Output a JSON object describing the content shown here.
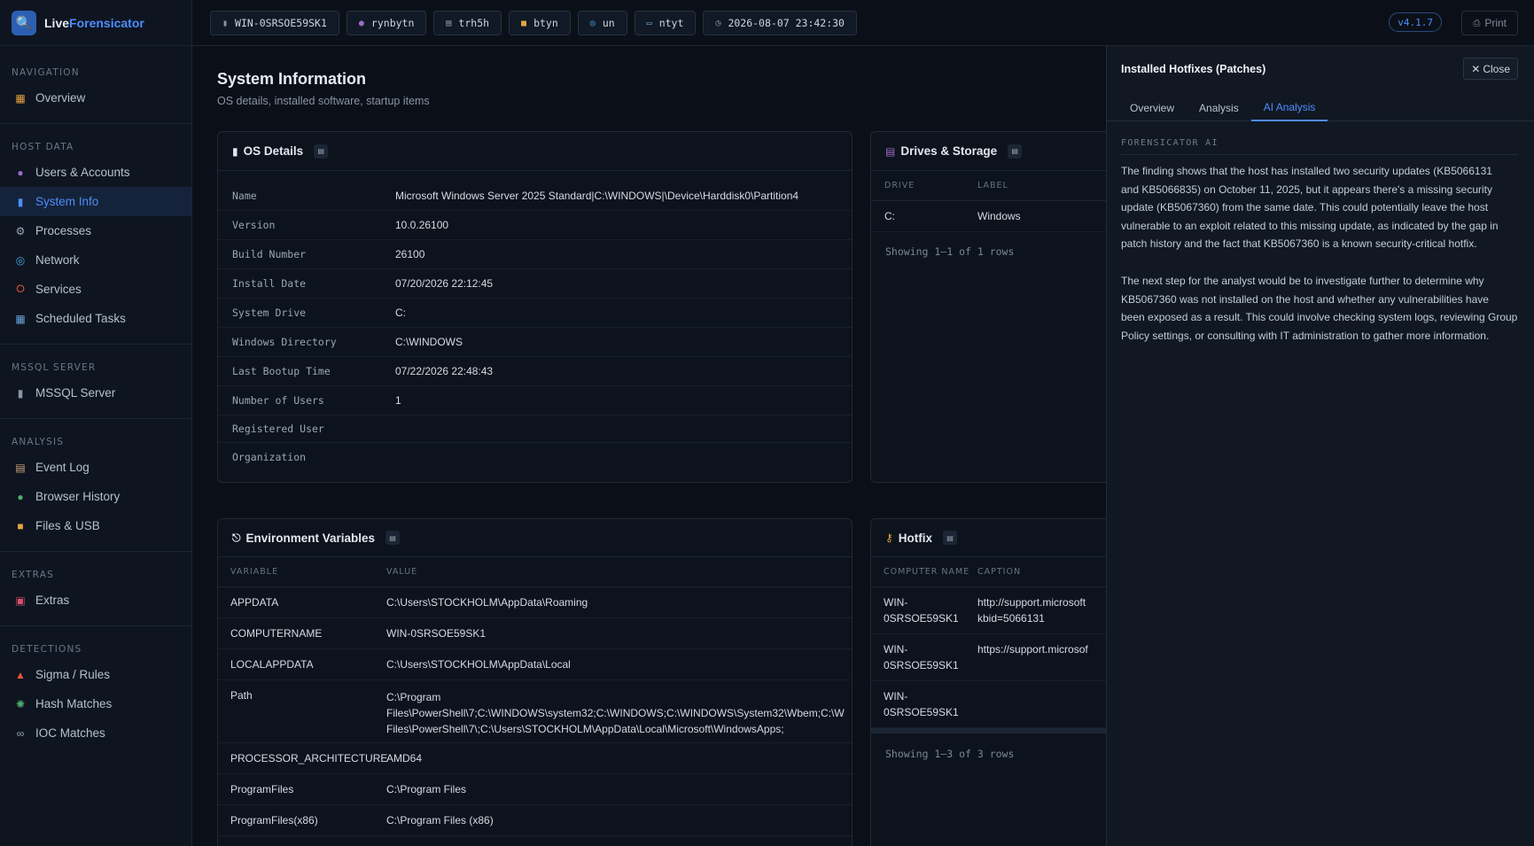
{
  "brand": {
    "prefix": "Live",
    "suffix": "Forensicator"
  },
  "sidebar": {
    "sections": [
      {
        "heading": "NAVIGATION",
        "items": [
          {
            "label": "Overview",
            "icon": "chart-icon"
          }
        ]
      },
      {
        "heading": "HOST DATA",
        "items": [
          {
            "label": "Users & Accounts",
            "icon": "user-icon"
          },
          {
            "label": "System Info",
            "icon": "computer-icon",
            "active": true
          },
          {
            "label": "Processes",
            "icon": "gear-icon"
          },
          {
            "label": "Network",
            "icon": "globe-icon"
          },
          {
            "label": "Services",
            "icon": "bolt-icon"
          },
          {
            "label": "Scheduled Tasks",
            "icon": "calendar-icon"
          }
        ]
      },
      {
        "heading": "MSSQL SERVER",
        "items": [
          {
            "label": "MSSQL Server",
            "icon": "database-icon"
          }
        ]
      },
      {
        "heading": "ANALYSIS",
        "items": [
          {
            "label": "Event Log",
            "icon": "log-icon"
          },
          {
            "label": "Browser History",
            "icon": "browser-icon"
          },
          {
            "label": "Files & USB",
            "icon": "folder-icon"
          }
        ]
      },
      {
        "heading": "EXTRAS",
        "items": [
          {
            "label": "Extras",
            "icon": "toolbox-icon"
          }
        ]
      },
      {
        "heading": "DETECTIONS",
        "items": [
          {
            "label": "Sigma / Rules",
            "icon": "alarm-icon"
          },
          {
            "label": "Hash Matches",
            "icon": "bug-icon"
          },
          {
            "label": "IOC Matches",
            "icon": "link-icon"
          }
        ]
      }
    ]
  },
  "topbar": {
    "chips": [
      {
        "label": "WIN-0SRSOE59SK1",
        "icon": "computer-icon"
      },
      {
        "label": "rynbytn",
        "icon": "user-icon"
      },
      {
        "label": "trh5h",
        "icon": "document-icon"
      },
      {
        "label": "btyn",
        "icon": "folder-icon"
      },
      {
        "label": "un",
        "icon": "globe-icon"
      },
      {
        "label": "ntyt",
        "icon": "monitor-icon"
      },
      {
        "label": "2026-08-07 23:42:30",
        "icon": "clock-icon"
      }
    ],
    "version": "v4.1.7",
    "print_label": "Print"
  },
  "page": {
    "title": "System Information",
    "subtitle": "OS details, installed software, startup items"
  },
  "os_details": {
    "title": "OS Details",
    "rows": [
      {
        "key": "Name",
        "value": "Microsoft Windows Server 2025 Standard|C:\\WINDOWS|\\Device\\Harddisk0\\Partition4"
      },
      {
        "key": "Version",
        "value": "10.0.26100"
      },
      {
        "key": "Build Number",
        "value": "26100"
      },
      {
        "key": "Install Date",
        "value": "07/20/2026 22:12:45"
      },
      {
        "key": "System Drive",
        "value": "C:"
      },
      {
        "key": "Windows Directory",
        "value": "C:\\WINDOWS"
      },
      {
        "key": "Last Bootup Time",
        "value": "07/22/2026 22:48:43"
      },
      {
        "key": "Number of Users",
        "value": "1"
      },
      {
        "key": "Registered User",
        "value": ""
      },
      {
        "key": "Organization",
        "value": ""
      }
    ]
  },
  "drives": {
    "title": "Drives & Storage",
    "columns": [
      "DRIVE",
      "LABEL"
    ],
    "rows": [
      {
        "drive": "C:",
        "label": "Windows"
      }
    ],
    "footer": "Showing 1–1 of 1 rows"
  },
  "env": {
    "title": "Environment Variables",
    "columns": [
      "VARIABLE",
      "VALUE"
    ],
    "rows": [
      {
        "name": "APPDATA",
        "value": "C:\\Users\\STOCKHOLM\\AppData\\Roaming"
      },
      {
        "name": "COMPUTERNAME",
        "value": "WIN-0SRSOE59SK1"
      },
      {
        "name": "LOCALAPPDATA",
        "value": "C:\\Users\\STOCKHOLM\\AppData\\Local"
      },
      {
        "name": "Path",
        "value_lines": [
          "C:\\Program",
          "Files\\PowerShell\\7;C:\\WINDOWS\\system32;C:\\WINDOWS;C:\\WINDOWS\\System32\\Wbem;C:\\W",
          "Files\\PowerShell\\7\\;C:\\Users\\STOCKHOLM\\AppData\\Local\\Microsoft\\WindowsApps;"
        ]
      },
      {
        "name": "PROCESSOR_ARCHITECTURE",
        "value": "AMD64"
      },
      {
        "name": "ProgramFiles",
        "value": "C:\\Program Files"
      },
      {
        "name": "ProgramFiles(x86)",
        "value": "C:\\Program Files (x86)"
      }
    ]
  },
  "hotfix": {
    "title": "Hotfix",
    "columns": [
      "COMPUTER NAME",
      "CAPTION"
    ],
    "rows": [
      {
        "name_lines": [
          "WIN-",
          "0SRSOE59SK1"
        ],
        "caption_lines": [
          "http://support.microsoft",
          "kbid=5066131"
        ]
      },
      {
        "name_lines": [
          "WIN-",
          "0SRSOE59SK1"
        ],
        "caption_lines": [
          "https://support.microsof"
        ]
      },
      {
        "name_lines": [
          "WIN-",
          "0SRSOE59SK1"
        ],
        "caption_lines": []
      }
    ],
    "footer": "Showing 1–3 of 3 rows"
  },
  "panel": {
    "title": "Installed Hotfixes (Patches)",
    "close_label": "Close",
    "tabs": [
      {
        "label": "Overview"
      },
      {
        "label": "Analysis"
      },
      {
        "label": "AI Analysis",
        "active": true
      }
    ],
    "ai_label": "FORENSICATOR AI",
    "paragraph1_lines": [
      "The finding shows that the host has installed two security updates (KB5066131",
      "and KB5066835) on October 11, 2025, but it appears there's a missing security",
      "update (KB5067360) from the same date. This could potentially leave the host",
      "vulnerable to an exploit related to this missing update, as indicated by the gap in",
      "patch history and the fact that KB5067360 is a known security-critical hotfix."
    ],
    "paragraph2_lines": [
      "The next step for the analyst would be to investigate further to determine why",
      "KB5067360 was not installed on the host and whether any vulnerabilities have",
      "been exposed as a result. This could involve checking system logs, reviewing Group",
      "Policy settings, or consulting with IT administration to gather more information."
    ]
  },
  "colors": {
    "accent": "#4d8dff",
    "background": "#0b1018",
    "panel": "#111822"
  }
}
